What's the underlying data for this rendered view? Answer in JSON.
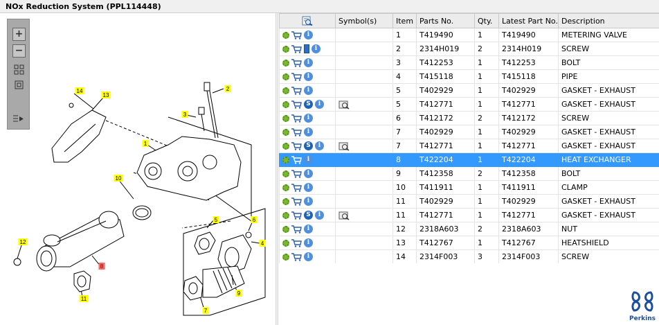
{
  "window": {
    "title": "NOx Reduction System (PPL114448)"
  },
  "columns": {
    "symbols": "Symbol(s)",
    "item": "Item",
    "parts_no": "Parts No.",
    "qty": "Qty.",
    "latest": "Latest Part No.",
    "description": "Description"
  },
  "parts": [
    {
      "item": "1",
      "part": "T419490",
      "qty": "1",
      "latest": "T419490",
      "desc": "METERING VALVE",
      "book": false,
      "s": false,
      "sym": false
    },
    {
      "item": "2",
      "part": "2314H019",
      "qty": "2",
      "latest": "2314H019",
      "desc": "SCREW",
      "book": true,
      "s": false,
      "sym": false
    },
    {
      "item": "3",
      "part": "T412253",
      "qty": "1",
      "latest": "T412253",
      "desc": "BOLT",
      "book": false,
      "s": false,
      "sym": false
    },
    {
      "item": "4",
      "part": "T415118",
      "qty": "1",
      "latest": "T415118",
      "desc": "PIPE",
      "book": false,
      "s": false,
      "sym": false
    },
    {
      "item": "5",
      "part": "T402929",
      "qty": "1",
      "latest": "T402929",
      "desc": "GASKET - EXHAUST",
      "book": false,
      "s": false,
      "sym": false
    },
    {
      "item": "5",
      "part": "T412771",
      "qty": "1",
      "latest": "T412771",
      "desc": "GASKET - EXHAUST",
      "book": false,
      "s": true,
      "sym": true
    },
    {
      "item": "6",
      "part": "T412172",
      "qty": "2",
      "latest": "T412172",
      "desc": "SCREW",
      "book": false,
      "s": false,
      "sym": false
    },
    {
      "item": "7",
      "part": "T402929",
      "qty": "1",
      "latest": "T402929",
      "desc": "GASKET - EXHAUST",
      "book": false,
      "s": false,
      "sym": false
    },
    {
      "item": "7",
      "part": "T412771",
      "qty": "1",
      "latest": "T412771",
      "desc": "GASKET - EXHAUST",
      "book": false,
      "s": true,
      "sym": true
    },
    {
      "item": "8",
      "part": "T422204",
      "qty": "1",
      "latest": "T422204",
      "desc": "HEAT EXCHANGER",
      "book": false,
      "s": false,
      "sym": false,
      "selected": true
    },
    {
      "item": "9",
      "part": "T412358",
      "qty": "2",
      "latest": "T412358",
      "desc": "BOLT",
      "book": false,
      "s": false,
      "sym": false
    },
    {
      "item": "10",
      "part": "T411911",
      "qty": "1",
      "latest": "T411911",
      "desc": "CLAMP",
      "book": false,
      "s": false,
      "sym": false
    },
    {
      "item": "11",
      "part": "T402929",
      "qty": "1",
      "latest": "T402929",
      "desc": "GASKET - EXHAUST",
      "book": false,
      "s": false,
      "sym": false
    },
    {
      "item": "11",
      "part": "T412771",
      "qty": "1",
      "latest": "T412771",
      "desc": "GASKET - EXHAUST",
      "book": false,
      "s": true,
      "sym": true
    },
    {
      "item": "12",
      "part": "2318A603",
      "qty": "2",
      "latest": "2318A603",
      "desc": "NUT",
      "book": false,
      "s": false,
      "sym": false
    },
    {
      "item": "13",
      "part": "T412767",
      "qty": "1",
      "latest": "T412767",
      "desc": "HEATSHIELD",
      "book": false,
      "s": false,
      "sym": false
    },
    {
      "item": "14",
      "part": "2314F003",
      "qty": "3",
      "latest": "2314F003",
      "desc": "SCREW",
      "book": false,
      "s": false,
      "sym": false
    }
  ],
  "callouts": [
    "1",
    "2",
    "3",
    "4",
    "5",
    "6",
    "7",
    "8",
    "9",
    "10",
    "11",
    "12",
    "13",
    "14"
  ],
  "colors": {
    "selection": "#3399ff",
    "callout": "#ffff00",
    "callout_selected": "#ff6666",
    "brand": "#1b4f9c"
  },
  "icons": {
    "gear": "gear-icon",
    "cart": "cart-icon",
    "info": "info-icon",
    "supersession": "s-icon",
    "document": "book-icon",
    "symbol": "symbol-icon",
    "search": "search-list-icon"
  },
  "brand": {
    "name": "Perkins"
  }
}
